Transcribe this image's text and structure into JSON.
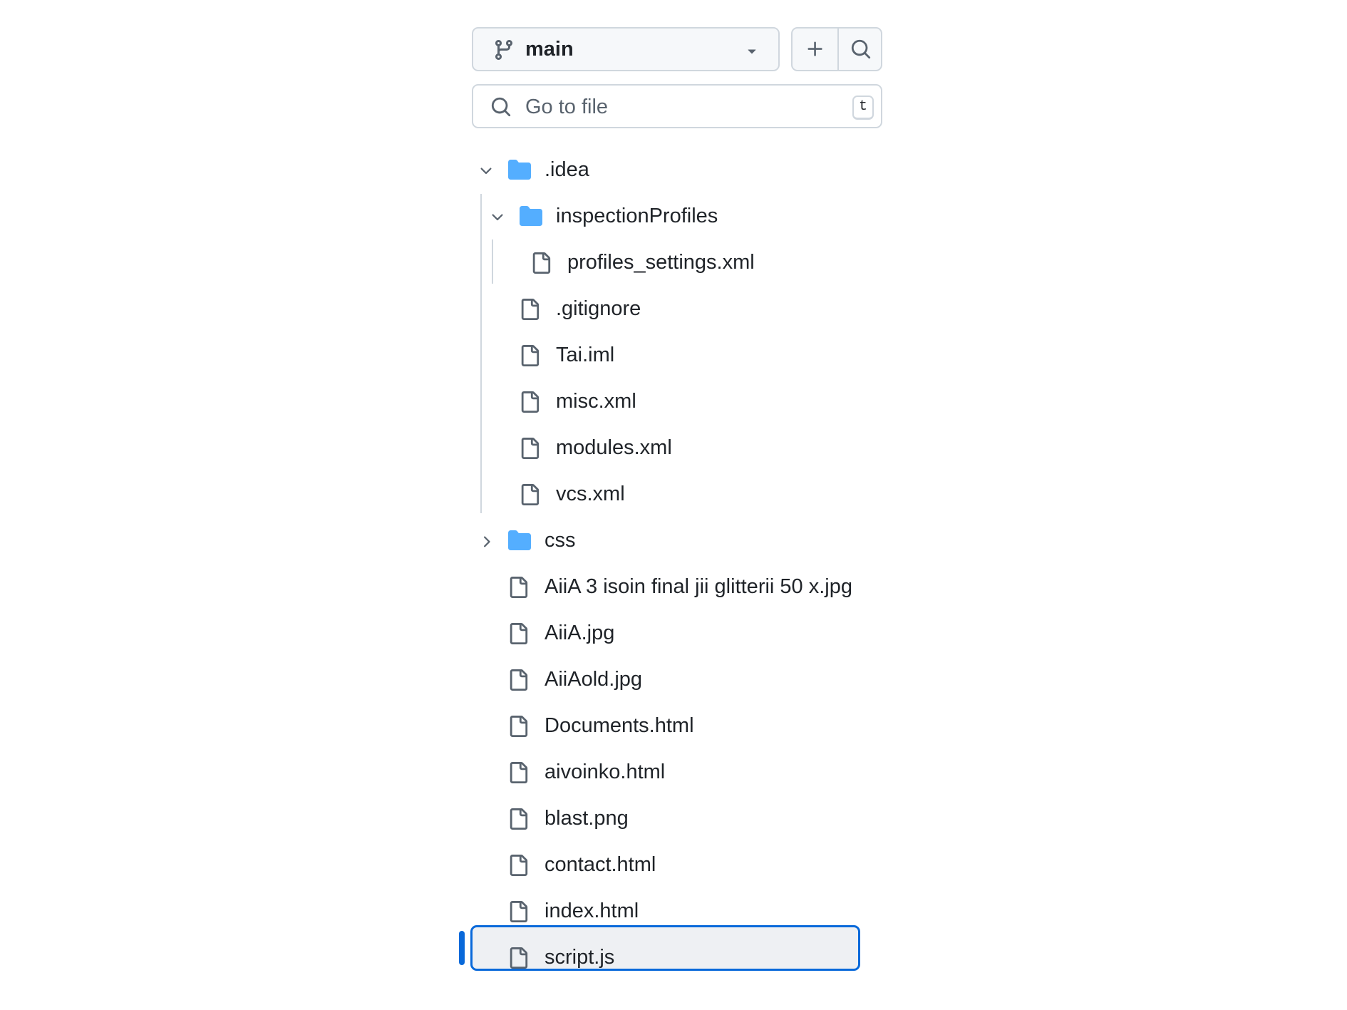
{
  "branch": {
    "name": "main",
    "icon": "git-branch-icon"
  },
  "actions": {
    "add_icon": "plus-icon",
    "search_icon": "search-icon"
  },
  "search": {
    "placeholder": "Go to file",
    "shortcut": "t"
  },
  "tree": [
    {
      "name": ".idea",
      "type": "folder",
      "expanded": true
    },
    {
      "name": "inspectionProfiles",
      "type": "folder",
      "expanded": true
    },
    {
      "name": "profiles_settings.xml",
      "type": "file"
    },
    {
      "name": ".gitignore",
      "type": "file"
    },
    {
      "name": "Tai.iml",
      "type": "file"
    },
    {
      "name": "misc.xml",
      "type": "file"
    },
    {
      "name": "modules.xml",
      "type": "file"
    },
    {
      "name": "vcs.xml",
      "type": "file"
    },
    {
      "name": "css",
      "type": "folder",
      "expanded": false
    },
    {
      "name": "AiiA 3 isoin final jii glitterii 50 x.jpg",
      "type": "file"
    },
    {
      "name": "AiiA.jpg",
      "type": "file"
    },
    {
      "name": "AiiAold.jpg",
      "type": "file"
    },
    {
      "name": "Documents.html",
      "type": "file"
    },
    {
      "name": "aivoinko.html",
      "type": "file"
    },
    {
      "name": "blast.png",
      "type": "file"
    },
    {
      "name": "contact.html",
      "type": "file"
    },
    {
      "name": "index.html",
      "type": "file"
    },
    {
      "name": "script.js",
      "type": "file",
      "selected": true
    }
  ],
  "colors": {
    "folder": "#54aeff",
    "accent": "#0969da",
    "border": "#d0d7de"
  }
}
